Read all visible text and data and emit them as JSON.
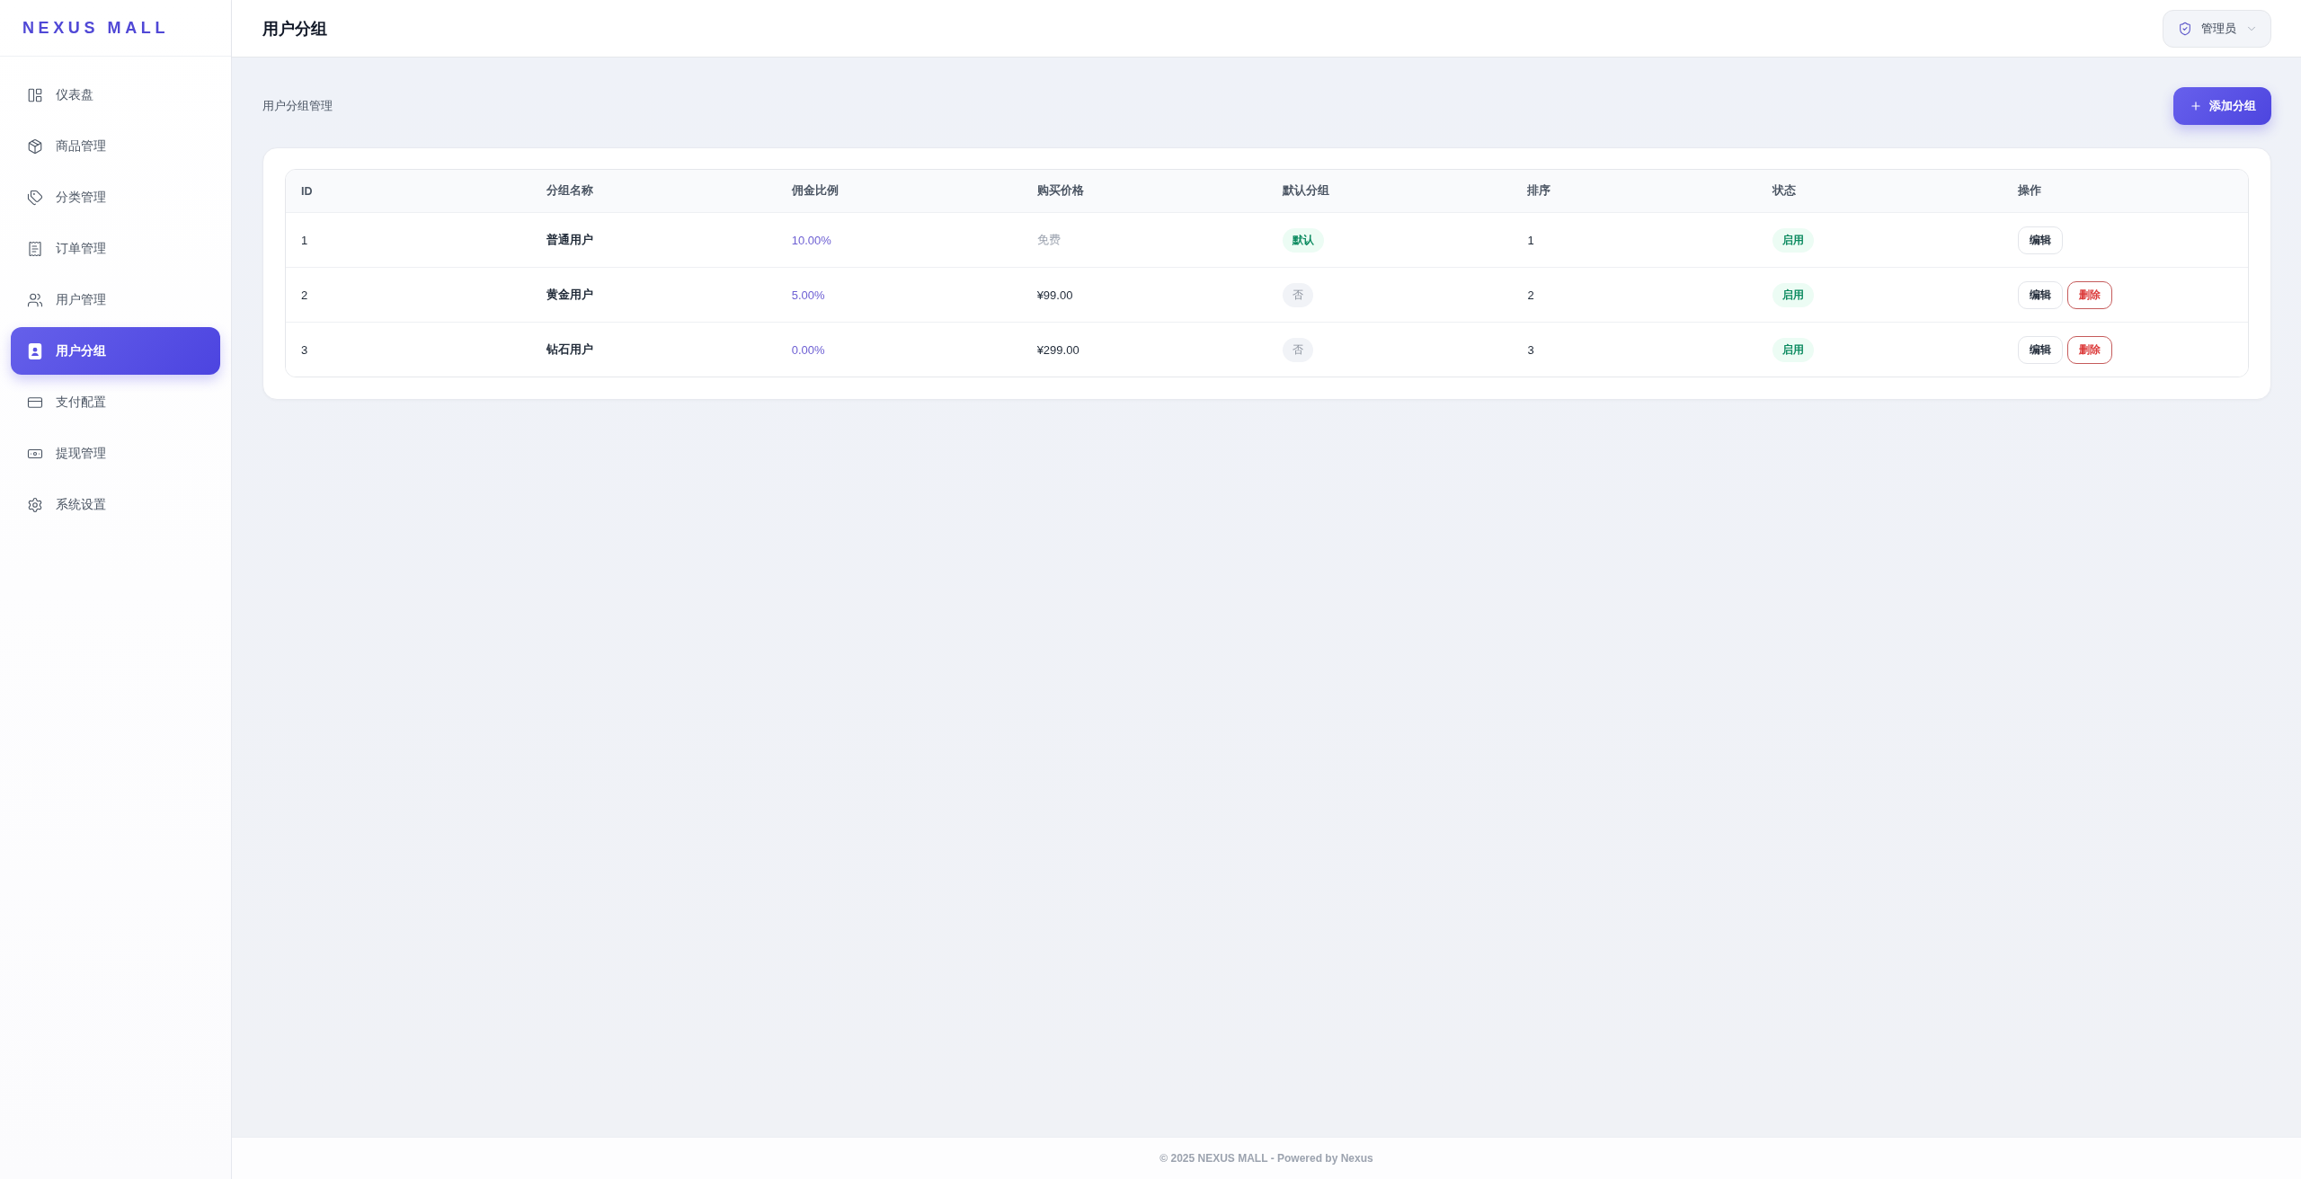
{
  "sidebar": {
    "logo": "NEXUS MALL",
    "items": [
      {
        "label": "仪表盘",
        "selected": false
      },
      {
        "label": "商品管理",
        "selected": false
      },
      {
        "label": "分类管理",
        "selected": false
      },
      {
        "label": "订单管理",
        "selected": false
      },
      {
        "label": "用户管理",
        "selected": false
      },
      {
        "label": "用户分组",
        "selected": true
      },
      {
        "label": "支付配置",
        "selected": false
      },
      {
        "label": "提现管理",
        "selected": false
      },
      {
        "label": "系统设置",
        "selected": false
      }
    ]
  },
  "header": {
    "title": "用户分组",
    "user_menu": {
      "label": "管理员"
    }
  },
  "page": {
    "subtitle": "用户分组管理",
    "add_button": "添加分组"
  },
  "table": {
    "columns": [
      "ID",
      "分组名称",
      "佣金比例",
      "购买价格",
      "默认分组",
      "排序",
      "状态",
      "操作"
    ],
    "rows": [
      {
        "id": "1",
        "name": "普通用户",
        "commission": "10.00%",
        "price": {
          "text": "免费",
          "free": true
        },
        "default": {
          "label": "默认",
          "on": true
        },
        "sort": "1",
        "status": {
          "label": "启用",
          "on": true
        },
        "actions": [
          {
            "kind": "edit",
            "label": "编辑"
          }
        ]
      },
      {
        "id": "2",
        "name": "黄金用户",
        "commission": "5.00%",
        "price": {
          "text": "¥99.00",
          "free": false
        },
        "default": {
          "label": "否",
          "on": false
        },
        "sort": "2",
        "status": {
          "label": "启用",
          "on": true
        },
        "actions": [
          {
            "kind": "edit",
            "label": "编辑"
          },
          {
            "kind": "delete",
            "label": "删除"
          }
        ]
      },
      {
        "id": "3",
        "name": "钻石用户",
        "commission": "0.00%",
        "price": {
          "text": "¥299.00",
          "free": false
        },
        "default": {
          "label": "否",
          "on": false
        },
        "sort": "3",
        "status": {
          "label": "启用",
          "on": true
        },
        "actions": [
          {
            "kind": "edit",
            "label": "编辑"
          },
          {
            "kind": "delete",
            "label": "删除"
          }
        ]
      }
    ]
  },
  "footer": {
    "text": "© 2025 NEXUS MALL - Powered by Nexus"
  }
}
